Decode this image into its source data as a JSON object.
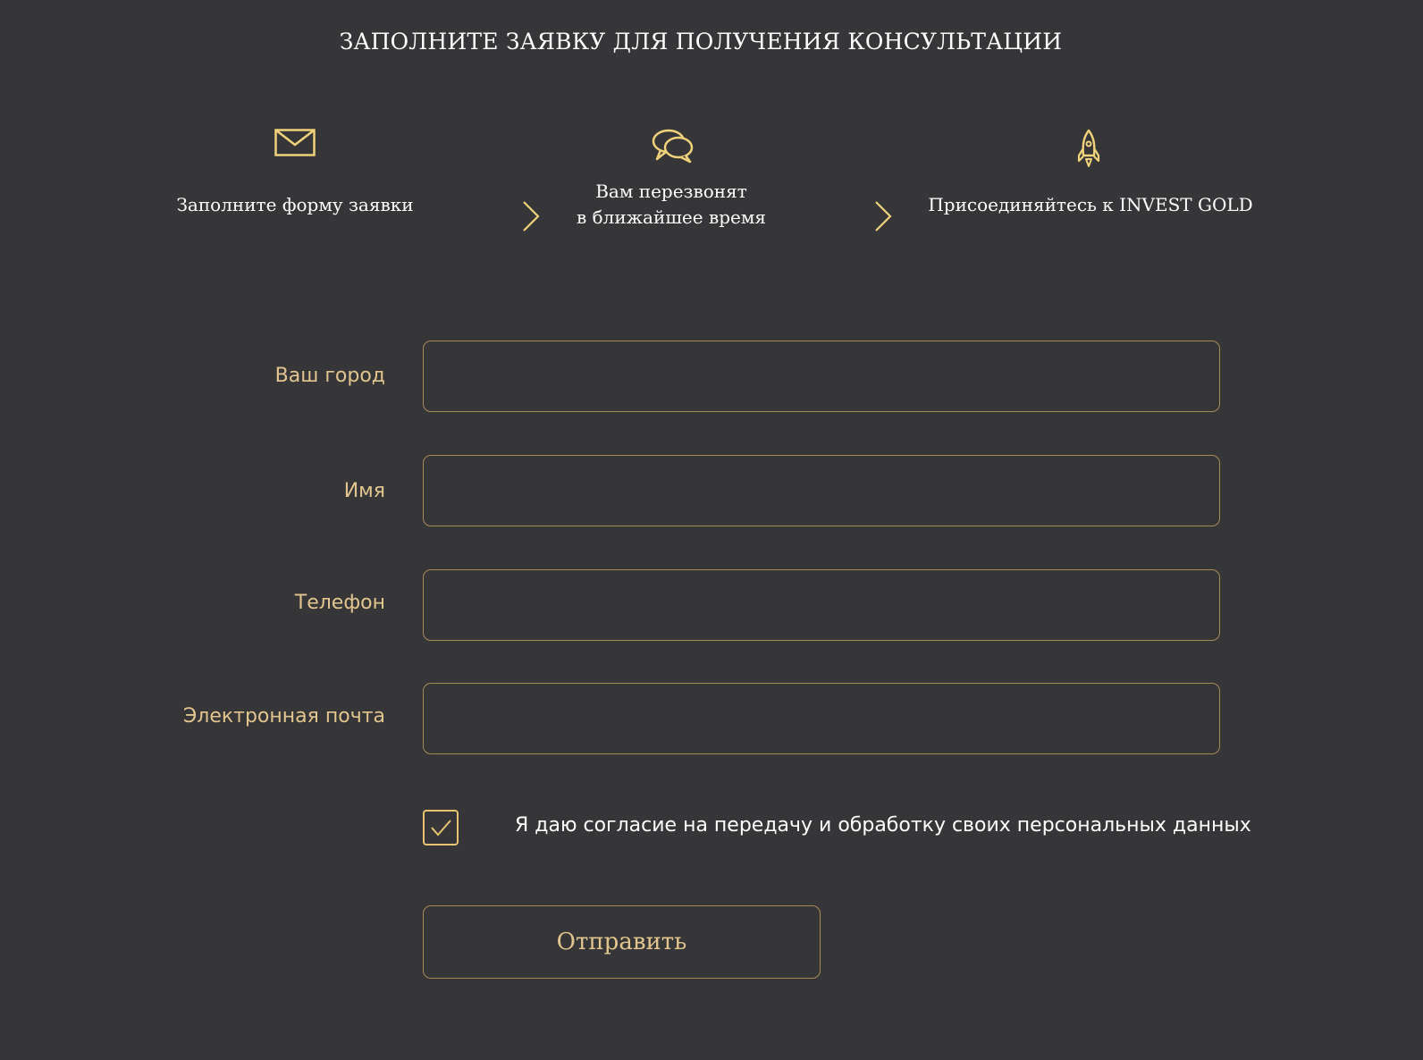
{
  "header": {
    "title": "ЗАПОЛНИТЕ ЗАЯВКУ ДЛЯ ПОЛУЧЕНИЯ КОНСУЛЬТАЦИИ"
  },
  "steps": [
    {
      "icon": "envelope-icon",
      "text": "Заполните форму заявки"
    },
    {
      "icon": "chat-bubbles-icon",
      "line1": "Вам перезвонят",
      "line2": "в ближайшее время"
    },
    {
      "icon": "rocket-icon",
      "text": "Присоединяйтесь к INVEST GOLD"
    }
  ],
  "form": {
    "fields": [
      {
        "label": "Ваш город",
        "value": ""
      },
      {
        "label": "Имя",
        "value": ""
      },
      {
        "label": "Телефон",
        "value": ""
      },
      {
        "label": "Электронная почта",
        "value": ""
      }
    ],
    "consent": {
      "checked": true,
      "label": "Я даю согласие на передачу и обработку своих персональных данных"
    },
    "submit_label": "Отправить"
  },
  "colors": {
    "background": "#363638",
    "accent_gold": "#e2c58e",
    "border_gold": "#a8895a",
    "text_white": "#ffffff"
  }
}
